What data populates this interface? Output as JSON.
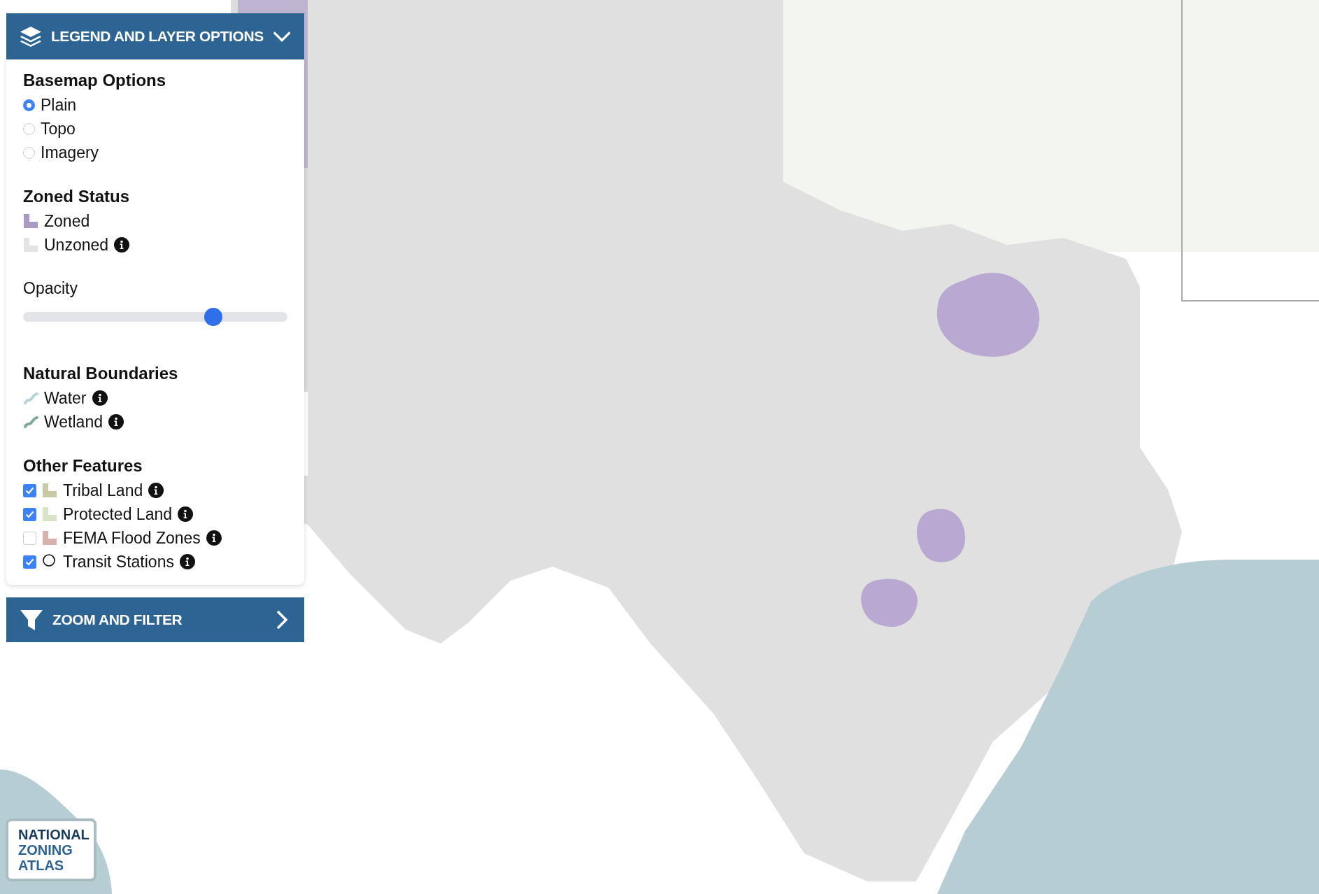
{
  "legend": {
    "title": "LEGEND AND LAYER OPTIONS",
    "expanded": true,
    "sections": [
      {
        "kind": "radio",
        "heading": "Basemap Options",
        "items": [
          {
            "label": "Plain",
            "selected": true
          },
          {
            "label": "Topo",
            "selected": false
          },
          {
            "label": "Imagery",
            "selected": false
          }
        ]
      },
      {
        "kind": "swatches",
        "heading": "Zoned Status",
        "items": [
          {
            "label": "Zoned",
            "color": "#a99bc4",
            "info": false
          },
          {
            "label": "Unzoned",
            "color": "#e3e3e3",
            "info": true
          }
        ]
      },
      {
        "kind": "slider",
        "heading": "Opacity",
        "level": 0.72
      },
      {
        "kind": "lines",
        "heading": "Natural Boundaries",
        "items": [
          {
            "label": "Water",
            "color": "#b5d3d6",
            "info": true
          },
          {
            "label": "Wetland",
            "color": "#7fa79a",
            "info": true
          }
        ]
      },
      {
        "kind": "checks",
        "heading": "Other Features",
        "items": [
          {
            "label": "Tribal Land",
            "checked": true,
            "kind": "swatch",
            "color": "#c9c9a8",
            "info": true
          },
          {
            "label": "Protected Land",
            "checked": true,
            "kind": "swatch",
            "color": "#d9e3c6",
            "info": true
          },
          {
            "label": "FEMA Flood Zones",
            "checked": false,
            "kind": "swatch",
            "color": "#d8b1ad",
            "info": true
          },
          {
            "label": "Transit Stations",
            "checked": true,
            "kind": "circle",
            "info": true
          }
        ]
      }
    ]
  },
  "zoom_filter": {
    "title": "ZOOM AND FILTER",
    "expanded": false
  },
  "logo": {
    "lines": [
      "NATIONAL",
      "ZONING",
      "ATLAS"
    ]
  }
}
